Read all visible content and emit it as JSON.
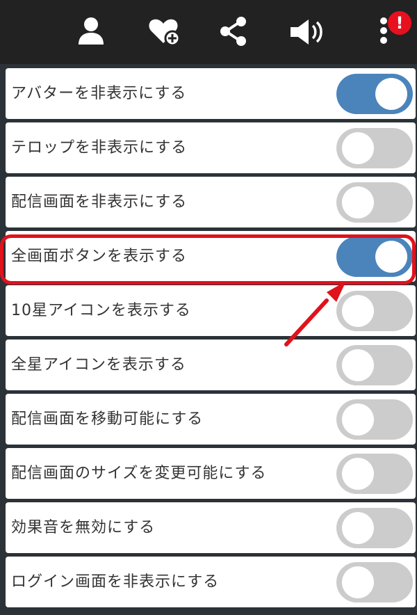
{
  "toolbar": {
    "icons": [
      "user-icon",
      "favorite-add-icon",
      "share-icon",
      "volume-icon",
      "more-vertical-icon"
    ],
    "notification_badge": "!"
  },
  "settings": [
    {
      "label": "アバターを非表示にする",
      "enabled": true
    },
    {
      "label": "テロップを非表示にする",
      "enabled": false
    },
    {
      "label": "配信画面を非表示にする",
      "enabled": false
    },
    {
      "label": "全画面ボタンを表示する",
      "enabled": true
    },
    {
      "label": "10星アイコンを表示する",
      "enabled": false
    },
    {
      "label": "全星アイコンを表示する",
      "enabled": false
    },
    {
      "label": "配信画面を移動可能にする",
      "enabled": false
    },
    {
      "label": "配信画面のサイズを変更可能にする",
      "enabled": false
    },
    {
      "label": "効果音を無効にする",
      "enabled": false
    },
    {
      "label": "ログイン画面を非表示にする",
      "enabled": false
    }
  ],
  "colors": {
    "toggle_on": "#4a84bb",
    "toggle_off": "#cccccc",
    "highlight": "#e0121c",
    "toolbar_bg": "#222222"
  }
}
